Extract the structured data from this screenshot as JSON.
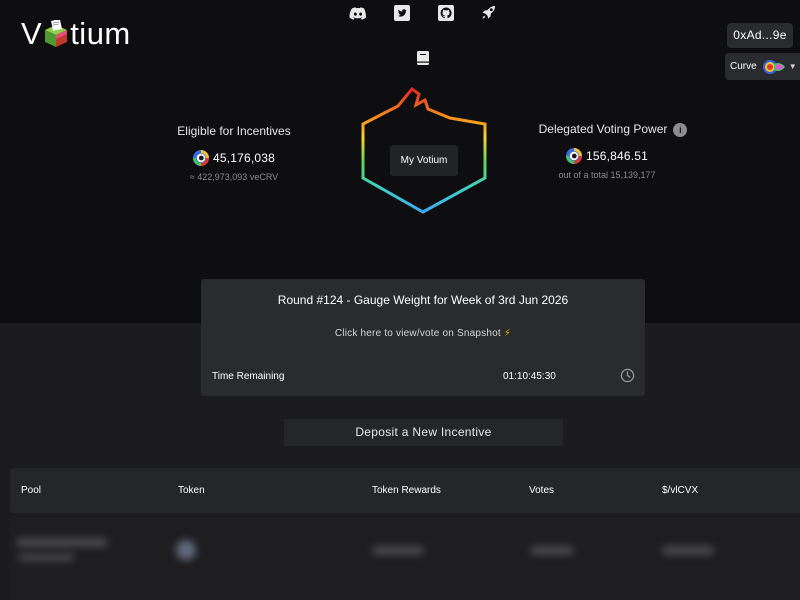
{
  "brand": {
    "logo_text_left": "V",
    "logo_text_right": "tium"
  },
  "social_icons": [
    "discord-icon",
    "twitter-icon",
    "github-icon",
    "rocket-icon"
  ],
  "docs_icon": "book-icon",
  "wallet": {
    "address": "0xAd...9e"
  },
  "network": {
    "label": "Curve"
  },
  "eligible": {
    "label": "Eligible for Incentives",
    "value": "45,176,038",
    "sub": "≈ 422,973,093 veCRV"
  },
  "delegated": {
    "label": "Delegated Voting Power",
    "value": "156,846.51",
    "sub": "out of a total 15,139,177"
  },
  "center": {
    "button": "My Votium"
  },
  "round": {
    "title": "Round #124 - Gauge Weight for Week of 3rd Jun 2026",
    "snapshot_link": "Click here to view/vote on Snapshot",
    "time_label": "Time Remaining",
    "time_value": "01:10:45:30"
  },
  "deposit": {
    "label": "Deposit a New Incentive"
  },
  "table": {
    "columns": [
      "Pool",
      "Token",
      "Token Rewards",
      "Votes",
      "$/vlCVX"
    ]
  },
  "colors": {
    "background_top": "#0e0e10",
    "background_lower": "#1c1c1e",
    "card": "#2a2b2d",
    "accent_bolt": "#f4b400"
  }
}
